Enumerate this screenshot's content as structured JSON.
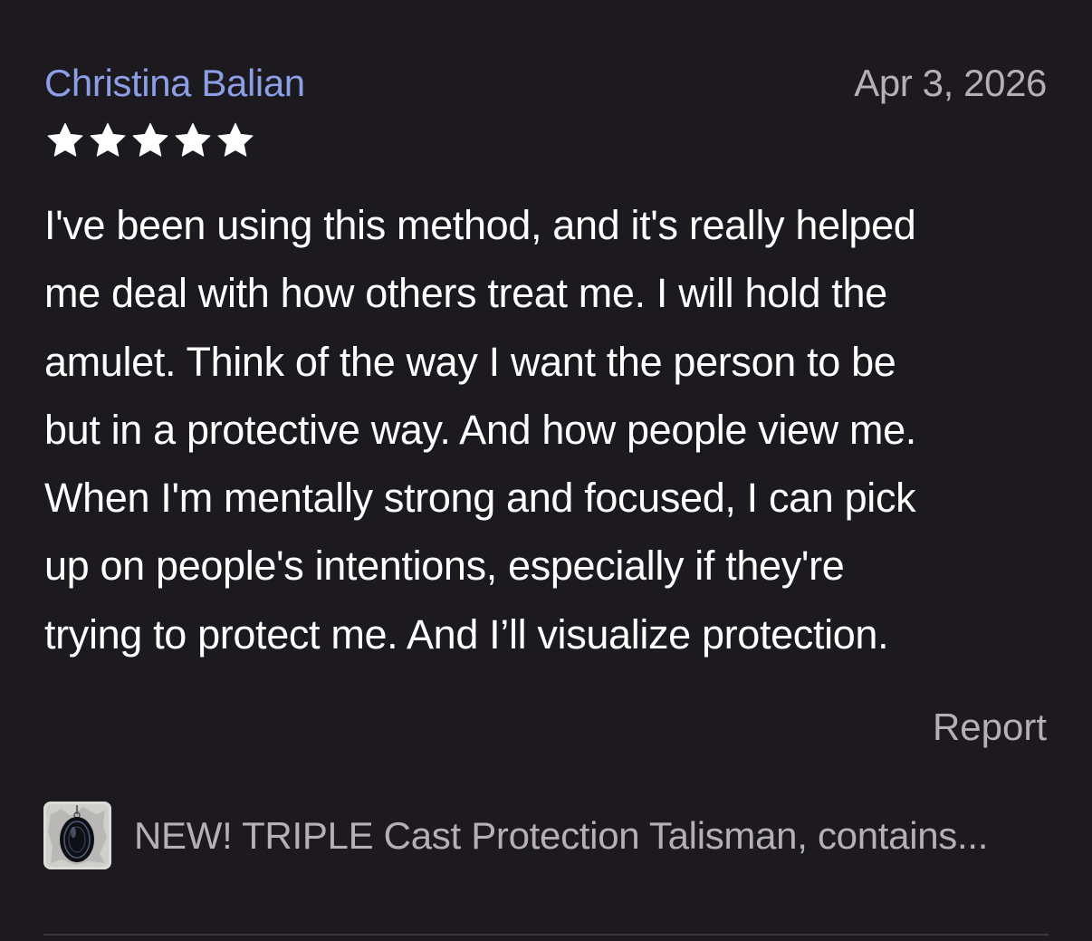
{
  "review": {
    "reviewer_name": "Christina Balian",
    "date": "Apr 3, 2026",
    "rating": 5,
    "rating_max": 5,
    "text": "I've been using this method, and it's really helped\nme deal with how others treat me. I will hold the\namulet. Think of the way I want the person to be\nbut in a protective way. And how people view me.\nWhen I'm mentally strong and focused, I can pick\nup on people's intentions, especially if they're\ntrying to protect me. And I’ll visualize protection.",
    "report_label": "Report"
  },
  "product": {
    "title": "NEW! TRIPLE Cast Protection Talisman, contains...",
    "thumbnail_icon": "talisman-thumbnail"
  },
  "colors": {
    "background": "#1c1a1f",
    "reviewer_name": "#8c9ee6",
    "secondary_text": "#b4b0b8",
    "body_text": "#ffffff",
    "star": "#ffffff",
    "divider": "#3a373e"
  }
}
